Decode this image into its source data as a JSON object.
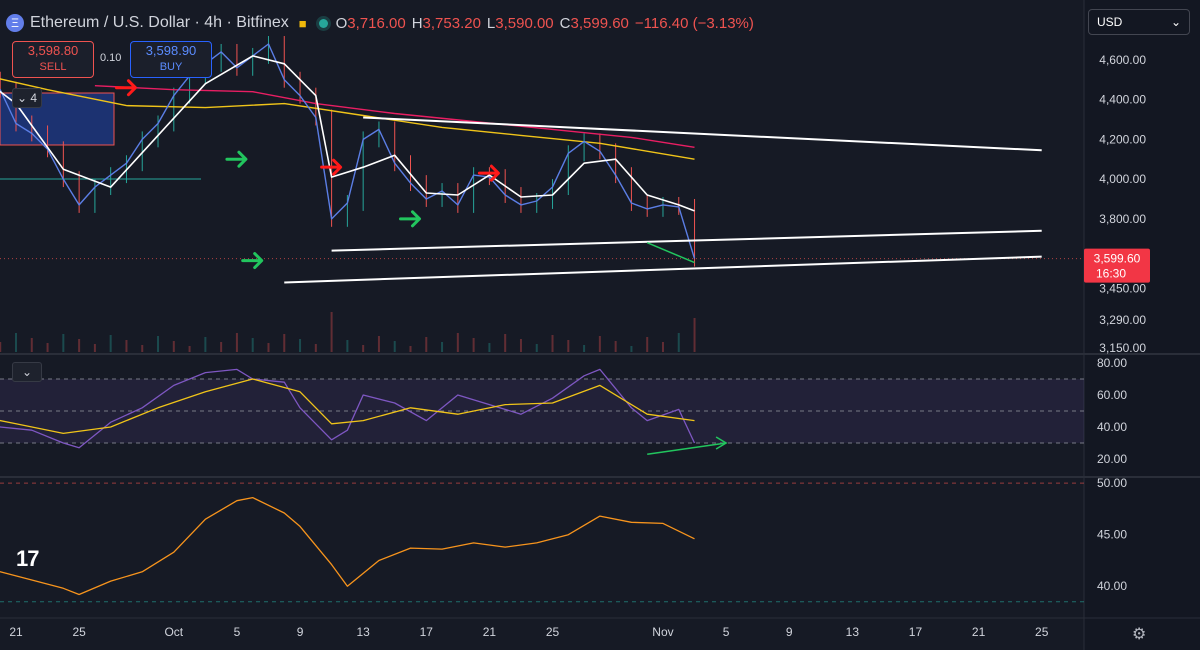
{
  "header": {
    "coin_icon": "ethereum-icon",
    "title": "Ethereum / U.S. Dollar · 4h · Bitfinex",
    "open_label": "O",
    "open": "3,716.00",
    "high_label": "H",
    "high": "3,753.20",
    "low_label": "L",
    "low": "3,590.00",
    "close_label": "C",
    "close": "3,599.60",
    "change": "−116.40 (−3.13%)"
  },
  "trade": {
    "sell_price": "3,598.80",
    "sell_label": "SELL",
    "spread": "0.10",
    "buy_price": "3,598.90",
    "buy_label": "BUY"
  },
  "indicator_count": "4",
  "currency": "USD",
  "price_tag": {
    "price": "3,599.60",
    "countdown": "16:30"
  },
  "colors": {
    "background": "#161a25",
    "up": "#26a69a",
    "down": "#ef5350",
    "ma_fast": "#ffffff",
    "ma_slow": "#f0c419",
    "ma_red": "#e91e63",
    "rsi": "#7e57c2",
    "rsi_ma": "#f0c419",
    "osc": "#f7941d",
    "annotation_green": "#22c55e",
    "annotation_red": "#ff1a1a"
  },
  "chart_data": [
    {
      "type": "line",
      "panel": "price",
      "title": "Ethereum / U.S. Dollar · 4h · Bitfinex",
      "x_ticks": [
        "21",
        "25",
        "Oct",
        "5",
        "9",
        "13",
        "17",
        "21",
        "25",
        "Nov",
        "5",
        "9",
        "13",
        "17",
        "21",
        "25"
      ],
      "y_ticks": [
        "4,600.00",
        "4,400.00",
        "4,200.00",
        "4,000.00",
        "3,800.00",
        "3,599.60",
        "3,450.00",
        "3,290.00",
        "3,150.00"
      ],
      "ylim": [
        3130,
        4700
      ],
      "series": [
        {
          "key": "close",
          "x": [
            "Sep 18",
            "Sep 19",
            "Sep 20",
            "Sep 21",
            "Sep 22",
            "Sep 23",
            "Sep 24",
            "Sep 25",
            "Sep 26",
            "Sep 27",
            "Sep 28",
            "Sep 29",
            "Sep 30",
            "Oct 1",
            "Oct 2",
            "Oct 3",
            "Oct 4",
            "Oct 5",
            "Oct 6",
            "Oct 7",
            "Oct 8",
            "Oct 9",
            "Oct 10",
            "Oct 11",
            "Oct 12",
            "Oct 13",
            "Oct 14",
            "Oct 15",
            "Oct 16",
            "Oct 17",
            "Oct 18",
            "Oct 19",
            "Oct 20",
            "Oct 21",
            "Oct 22",
            "Oct 23",
            "Oct 24",
            "Oct 25",
            "Oct 26",
            "Oct 27",
            "Oct 28",
            "Oct 29",
            "Oct 30",
            "Oct 31",
            "Nov 1",
            "Nov 2",
            "Nov 3"
          ],
          "values": [
            4620,
            4500,
            4450,
            4280,
            4230,
            4150,
            4000,
            3870,
            3960,
            4020,
            4080,
            4200,
            4280,
            4420,
            4520,
            4580,
            4640,
            4560,
            4620,
            4680,
            4500,
            4420,
            4310,
            3800,
            3880,
            4200,
            4250,
            4080,
            3980,
            3900,
            3940,
            3870,
            4020,
            4010,
            3920,
            3870,
            3890,
            3960,
            4130,
            4190,
            4140,
            4020,
            3880,
            3850,
            3870,
            3860,
            3600
          ]
        },
        {
          "key": "ma_fast",
          "x": [
            "Sep 18",
            "Sep 21",
            "Sep 24",
            "Sep 27",
            "Sep 30",
            "Oct 3",
            "Oct 6",
            "Oct 8",
            "Oct 10",
            "Oct 11",
            "Oct 13",
            "Oct 15",
            "Oct 17",
            "Oct 19",
            "Oct 21",
            "Oct 23",
            "Oct 25",
            "Oct 27",
            "Oct 29",
            "Oct 31",
            "Nov 2",
            "Nov 3"
          ],
          "values": [
            4560,
            4380,
            4050,
            3960,
            4220,
            4480,
            4620,
            4580,
            4420,
            4010,
            4060,
            4120,
            3930,
            3920,
            4020,
            3910,
            3920,
            4080,
            4100,
            3920,
            3870,
            3840
          ]
        },
        {
          "key": "ma_slow",
          "x": [
            "Sep 18",
            "Sep 23",
            "Sep 28",
            "Oct 3",
            "Oct 8",
            "Oct 13",
            "Oct 18",
            "Oct 23",
            "Oct 28",
            "Nov 3"
          ],
          "values": [
            4540,
            4450,
            4370,
            4360,
            4380,
            4320,
            4260,
            4220,
            4180,
            4100
          ]
        },
        {
          "key": "ma_red",
          "x": [
            "Sep 26",
            "Oct 1",
            "Oct 6",
            "Oct 10",
            "Oct 15",
            "Oct 20",
            "Oct 25",
            "Oct 30",
            "Nov 3"
          ],
          "values": [
            4470,
            4450,
            4440,
            4380,
            4330,
            4290,
            4250,
            4210,
            4160
          ]
        }
      ]
    },
    {
      "type": "line",
      "panel": "rsi",
      "y_ticks": [
        "80.00",
        "60.00",
        "40.00",
        "20.00"
      ],
      "ylim": [
        10,
        85
      ],
      "bands": [
        70,
        50,
        30
      ],
      "series": [
        {
          "key": "rsi",
          "x": [
            "Sep 18",
            "Sep 20",
            "Sep 22",
            "Sep 24",
            "Sep 25",
            "Sep 27",
            "Sep 29",
            "Oct 1",
            "Oct 3",
            "Oct 5",
            "Oct 6",
            "Oct 8",
            "Oct 9",
            "Oct 11",
            "Oct 12",
            "Oct 13",
            "Oct 15",
            "Oct 17",
            "Oct 19",
            "Oct 21",
            "Oct 23",
            "Oct 25",
            "Oct 27",
            "Oct 28",
            "Oct 30",
            "Oct 31",
            "Nov 2",
            "Nov 3"
          ],
          "values": [
            50,
            40,
            38,
            30,
            27,
            43,
            52,
            66,
            74,
            76,
            70,
            68,
            52,
            32,
            38,
            60,
            55,
            44,
            60,
            54,
            48,
            58,
            72,
            76,
            52,
            44,
            51,
            30
          ]
        },
        {
          "key": "rsi_ma",
          "x": [
            "Sep 18",
            "Sep 21",
            "Sep 24",
            "Sep 27",
            "Sep 30",
            "Oct 3",
            "Oct 6",
            "Oct 9",
            "Oct 11",
            "Oct 13",
            "Oct 16",
            "Oct 19",
            "Oct 22",
            "Oct 25",
            "Oct 28",
            "Oct 31",
            "Nov 3"
          ],
          "values": [
            48,
            42,
            36,
            40,
            52,
            62,
            70,
            62,
            42,
            44,
            52,
            48,
            54,
            55,
            66,
            48,
            44
          ]
        }
      ]
    },
    {
      "type": "line",
      "panel": "oscillator",
      "y_ticks": [
        "50.00",
        "45.00",
        "40.00"
      ],
      "ylim": [
        37.5,
        50.5
      ],
      "bands": [
        50,
        38.5
      ],
      "series": [
        {
          "key": "osc",
          "x": [
            "Sep 18",
            "Sep 20",
            "Sep 22",
            "Sep 24",
            "Sep 25",
            "Sep 27",
            "Sep 29",
            "Oct 1",
            "Oct 3",
            "Oct 5",
            "Oct 6",
            "Oct 8",
            "Oct 9",
            "Oct 11",
            "Oct 12",
            "Oct 14",
            "Oct 16",
            "Oct 18",
            "Oct 20",
            "Oct 22",
            "Oct 24",
            "Oct 26",
            "Oct 28",
            "Oct 30",
            "Nov 1",
            "Nov 3"
          ],
          "values": [
            42.2,
            41.4,
            40.6,
            39.8,
            39.2,
            40.5,
            41.4,
            43.3,
            46.5,
            48.3,
            48.6,
            47.1,
            45.8,
            42.1,
            40.0,
            42.5,
            43.7,
            43.6,
            44.2,
            43.8,
            44.2,
            45.0,
            46.8,
            46.2,
            46.1,
            44.6
          ]
        }
      ]
    }
  ],
  "x_axis_dates": {
    "21": "Sep 21",
    "25": "Sep 25",
    "Oct": "Oct 1",
    "5": "Oct 5",
    "9": "Oct 9",
    "13": "Oct 13",
    "17": "Oct 17",
    "21b": "Oct 21",
    "25b": "Oct 25",
    "Nov": "Nov 1",
    "5b": "Nov 5",
    "9b": "Nov 9",
    "13b": "Nov 13",
    "17b": "Nov 17",
    "21c": "Nov 21",
    "25c": "Nov 25"
  },
  "annotations": {
    "trendlines": [
      {
        "from": [
          "Oct 13",
          4310
        ],
        "to": [
          "Nov 25",
          4145
        ]
      },
      {
        "from": [
          "Oct 11",
          3640
        ],
        "to": [
          "Nov 25",
          3740
        ]
      },
      {
        "from": [
          "Oct 8",
          3480
        ],
        "to": [
          "Nov 25",
          3610
        ]
      }
    ],
    "divergence_price": {
      "from": [
        "Oct 31",
        3680
      ],
      "to": [
        "Nov 3",
        3580
      ]
    },
    "divergence_rsi": {
      "from": [
        "Oct 31",
        23
      ],
      "to": [
        "Nov 5",
        30
      ]
    },
    "arrows_green": [
      [
        "Oct 5",
        4100
      ],
      [
        "Oct 16",
        3800
      ],
      [
        "Oct 6",
        3590
      ]
    ],
    "arrows_red": [
      [
        "Sep 28",
        4460
      ],
      [
        "Oct 11",
        4060
      ],
      [
        "Oct 21",
        4030
      ]
    ]
  }
}
